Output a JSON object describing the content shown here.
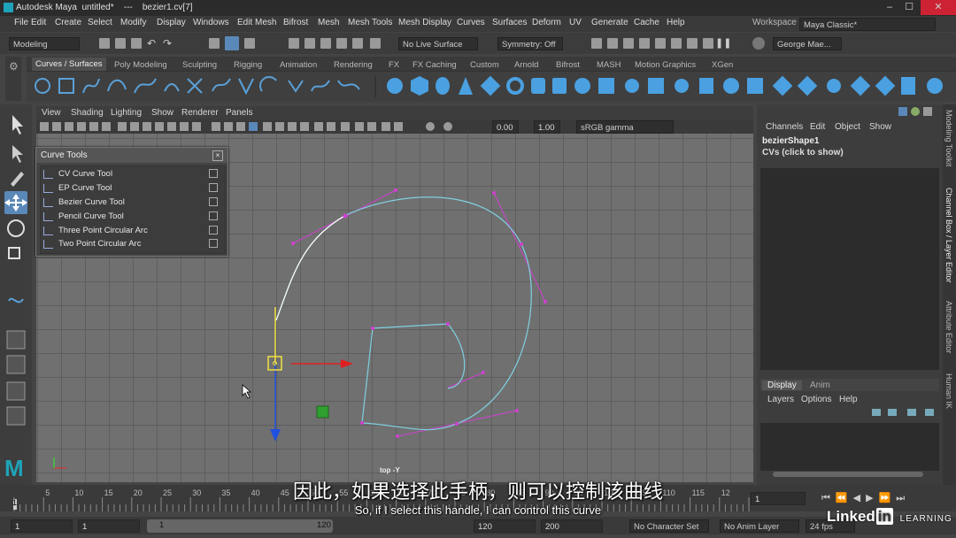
{
  "window": {
    "title": "Autodesk Maya  untitled*    ---    bezier1.cv[7]"
  },
  "menubar": [
    "File",
    "Edit",
    "Create",
    "Select",
    "Modify",
    "Display",
    "Windows",
    "Edit Mesh",
    "Bifrost",
    "Mesh",
    "Mesh Tools",
    "Mesh Display",
    "Curves",
    "Surfaces",
    "Deform",
    "UV",
    "Generate",
    "Cache",
    "Help"
  ],
  "workspace": {
    "label": "Workspace :",
    "value": "Maya Classic*"
  },
  "statusline": {
    "mode": "Modeling",
    "live_surface": "No Live Surface",
    "symmetry": "Symmetry: Off",
    "user": "George Mae..."
  },
  "shelf": {
    "tabs": [
      "Curves / Surfaces",
      "Poly Modeling",
      "Sculpting",
      "Rigging",
      "Animation",
      "Rendering",
      "FX",
      "FX Caching",
      "Custom",
      "Arnold",
      "Bifrost",
      "MASH",
      "Motion Graphics",
      "XGen"
    ],
    "active": "Curves / Surfaces"
  },
  "viewport": {
    "menus": [
      "View",
      "Shading",
      "Lighting",
      "Show",
      "Renderer",
      "Panels"
    ],
    "exposure": "0.00",
    "gamma": "1.00",
    "colorspace": "sRGB gamma",
    "camera_label": "top -Y"
  },
  "curve_tools": {
    "title": "Curve Tools",
    "items": [
      "CV Curve Tool",
      "EP Curve Tool",
      "Bezier Curve Tool",
      "Pencil Curve Tool",
      "Three Point Circular Arc",
      "Two Point Circular Arc"
    ]
  },
  "channel_box": {
    "menus": [
      "Channels",
      "Edit",
      "Object",
      "Show"
    ],
    "shape": "bezierShape1",
    "cvs": "CVs (click to show)"
  },
  "layer_editor": {
    "tabs": [
      "Display",
      "Anim"
    ],
    "menus": [
      "Layers",
      "Options",
      "Help"
    ]
  },
  "side_tabs": [
    "Modeling Toolkit",
    "Channel Box / Layer Editor",
    "Attribute Editor",
    "Human IK"
  ],
  "timeline": {
    "ticks": [
      "5",
      "10",
      "15",
      "20",
      "25",
      "30",
      "35",
      "40",
      "45",
      "50",
      "55",
      "60",
      "65",
      "70",
      "75",
      "80",
      "85",
      "90",
      "95",
      "100",
      "105",
      "110",
      "115",
      "12"
    ],
    "start_label": "1",
    "current_frame": "1"
  },
  "range": {
    "start": "1",
    "anim_start": "1",
    "range_start": "1",
    "range_end": "120",
    "anim_end": "120",
    "end": "200",
    "character_set": "No Character Set",
    "anim_layer": "No Anim Layer",
    "fps": "24 fps"
  },
  "subtitles": {
    "chinese": "因此，如果选择此手柄，则可以控制该曲线",
    "english": "So, if I select this handle, I can control this curve"
  },
  "watermark": {
    "brand": "Linked",
    "brand_in": "in",
    "learning": "LEARNING"
  },
  "colors": {
    "curve": "#7fd0e0",
    "cv": "#d040d0",
    "grid": "#707070",
    "accent": "#5a88b8"
  }
}
